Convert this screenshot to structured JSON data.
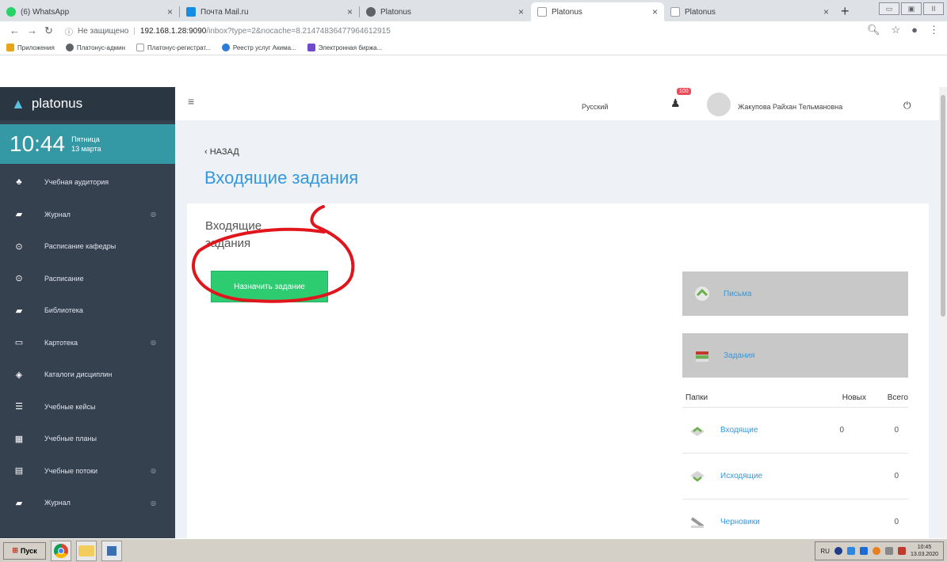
{
  "browser": {
    "tabs": [
      {
        "title": "(6) WhatsApp",
        "favicon_color": "#25d366",
        "active": false
      },
      {
        "title": "Почта Mail.ru",
        "favicon_color": "#168de2",
        "active": false
      },
      {
        "title": "Platonus",
        "favicon_color": "#5f6368",
        "active": false
      },
      {
        "title": "Platonus",
        "favicon_color": "#9aa0a6",
        "active": true
      },
      {
        "title": "Platonus",
        "favicon_color": "#9aa0a6",
        "active": false
      }
    ],
    "close_glyph": "×",
    "new_tab_glyph": "+",
    "window_controls": [
      "▭",
      "▣",
      "II"
    ],
    "insecure_label": "Не защищено",
    "url_host": "192.168.1.28:9090",
    "url_path": "/inbox?type=2&nocache=8.21474836477964612915",
    "bookmarks": [
      {
        "label": "Приложения",
        "icon_color": "#e8a317"
      },
      {
        "label": "Платонус-админ",
        "icon_color": "#5f6368"
      },
      {
        "label": "Платонус-регистрат...",
        "icon_color": "#9aa0a6"
      },
      {
        "label": "Реестр услуг Акима...",
        "icon_color": "#2e7bd6"
      },
      {
        "label": "Электронная биржа...",
        "icon_color": "#6f4acb"
      }
    ]
  },
  "sidebar": {
    "brand": "platonus",
    "time": "10:44",
    "weekday": "Пятница",
    "date": "13 марта",
    "items": [
      {
        "label": "Учебная аудитория",
        "icon": "users-icon",
        "glyph": "♣",
        "has_arrow": false
      },
      {
        "label": "Журнал",
        "icon": "book-icon",
        "glyph": "▰",
        "has_arrow": true
      },
      {
        "label": "Расписание кафедры",
        "icon": "clock-icon",
        "glyph": "⊙",
        "has_arrow": false
      },
      {
        "label": "Расписание",
        "icon": "clock-icon",
        "glyph": "⊙",
        "has_arrow": false
      },
      {
        "label": "Библиотека",
        "icon": "book-icon",
        "glyph": "▰",
        "has_arrow": false
      },
      {
        "label": "Картотека",
        "icon": "folder-icon",
        "glyph": "▭",
        "has_arrow": true
      },
      {
        "label": "Каталоги дисциплин",
        "icon": "catalog-icon",
        "glyph": "◈",
        "has_arrow": false
      },
      {
        "label": "Учебные кейсы",
        "icon": "list-icon",
        "glyph": "☰",
        "has_arrow": false
      },
      {
        "label": "Учебные планы",
        "icon": "grid-icon",
        "glyph": "▦",
        "has_arrow": false
      },
      {
        "label": "Учебные потоки",
        "icon": "file-icon",
        "glyph": "▤",
        "has_arrow": true
      },
      {
        "label": "Журнал",
        "icon": "book-icon",
        "glyph": "▰",
        "has_arrow": true
      }
    ],
    "arrow_glyph": "◎"
  },
  "header": {
    "language": "Русский",
    "notification_count": "100",
    "user_name": "Жакупова Райхан Тельмановна"
  },
  "page": {
    "back_label": "НАЗАД",
    "title": "Входящие задания",
    "panel_title": "Входящие задания",
    "assign_button": "Назначить задание",
    "letters_label": "Письма",
    "tasks_label": "Задания",
    "folders_header": {
      "name": "Папки",
      "new": "Новых",
      "total": "Всего"
    },
    "folders": [
      {
        "name": "Входящие",
        "new": "0",
        "total": "0"
      },
      {
        "name": "Исходящие",
        "new": "",
        "total": "0"
      },
      {
        "name": "Черновики",
        "new": "",
        "total": "0"
      }
    ],
    "annotation_color": "#e0161c"
  },
  "taskbar": {
    "start_label": "Пуск",
    "language": "RU",
    "time": "10:45",
    "date": "13.03.2020"
  }
}
